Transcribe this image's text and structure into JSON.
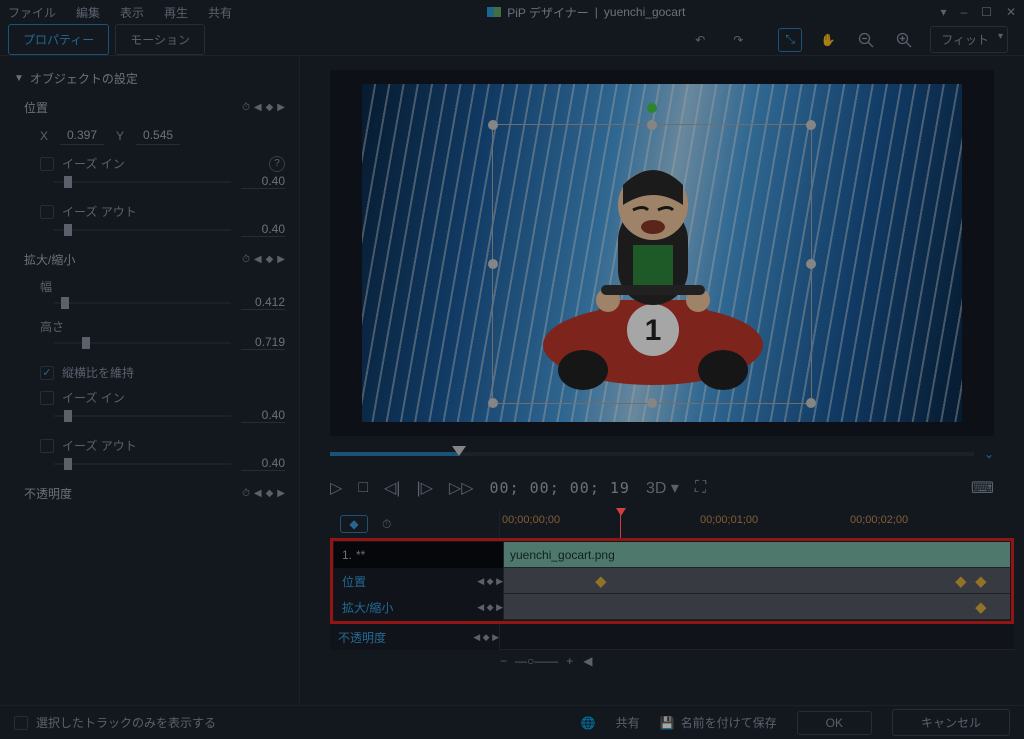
{
  "titlebar": {
    "menus": [
      "ファイル",
      "編集",
      "表示",
      "再生",
      "共有"
    ],
    "app": "PiP デザイナー",
    "sep": "|",
    "filename": "yuenchi_gocart"
  },
  "winControls": {
    "down": "▾",
    "min": "–",
    "max": "☐",
    "close": "✕"
  },
  "tabs": {
    "property": "プロパティー",
    "motion": "モーション"
  },
  "previewTools": {
    "undo": "↶",
    "redo": "↷",
    "move": "⤡",
    "hand": "✋",
    "zoomOut": "–",
    "zoomIn": "+",
    "fit": "フィット"
  },
  "sidebar": {
    "sectionTitle": "オブジェクトの設定",
    "position": {
      "title": "位置",
      "xLabel": "X",
      "xVal": "0.397",
      "yLabel": "Y",
      "yVal": "0.545",
      "easeIn": "イーズ イン",
      "easeInVal": "0.40",
      "easeOut": "イーズ アウト",
      "easeOutVal": "0.40"
    },
    "scale": {
      "title": "拡大/縮小",
      "widthLabel": "幅",
      "widthVal": "0.412",
      "heightLabel": "高さ",
      "heightVal": "0.719",
      "keepAspect": "縦横比を維持",
      "easeIn": "イーズ イン",
      "easeInVal": "0.40",
      "easeOut": "イーズ アウト",
      "easeOutVal": "0.40"
    },
    "opacity": {
      "title": "不透明度"
    }
  },
  "playback": {
    "timecode": "00; 00; 00; 19",
    "threeD": "3D"
  },
  "timeline": {
    "ticks": [
      "00;00;00;00",
      "00;00;01;00",
      "00;00;02;00"
    ],
    "clip": {
      "index": "1.",
      "star": "**",
      "name": "yuenchi_gocart.png"
    },
    "tracks": {
      "position": "位置",
      "scale": "拡大/縮小",
      "opacity": "不透明度"
    }
  },
  "bottom": {
    "showSelectedOnly": "選択したトラックのみを表示する",
    "share": "共有",
    "saveAs": "名前を付けて保存",
    "ok": "OK",
    "cancel": "キャンセル"
  }
}
